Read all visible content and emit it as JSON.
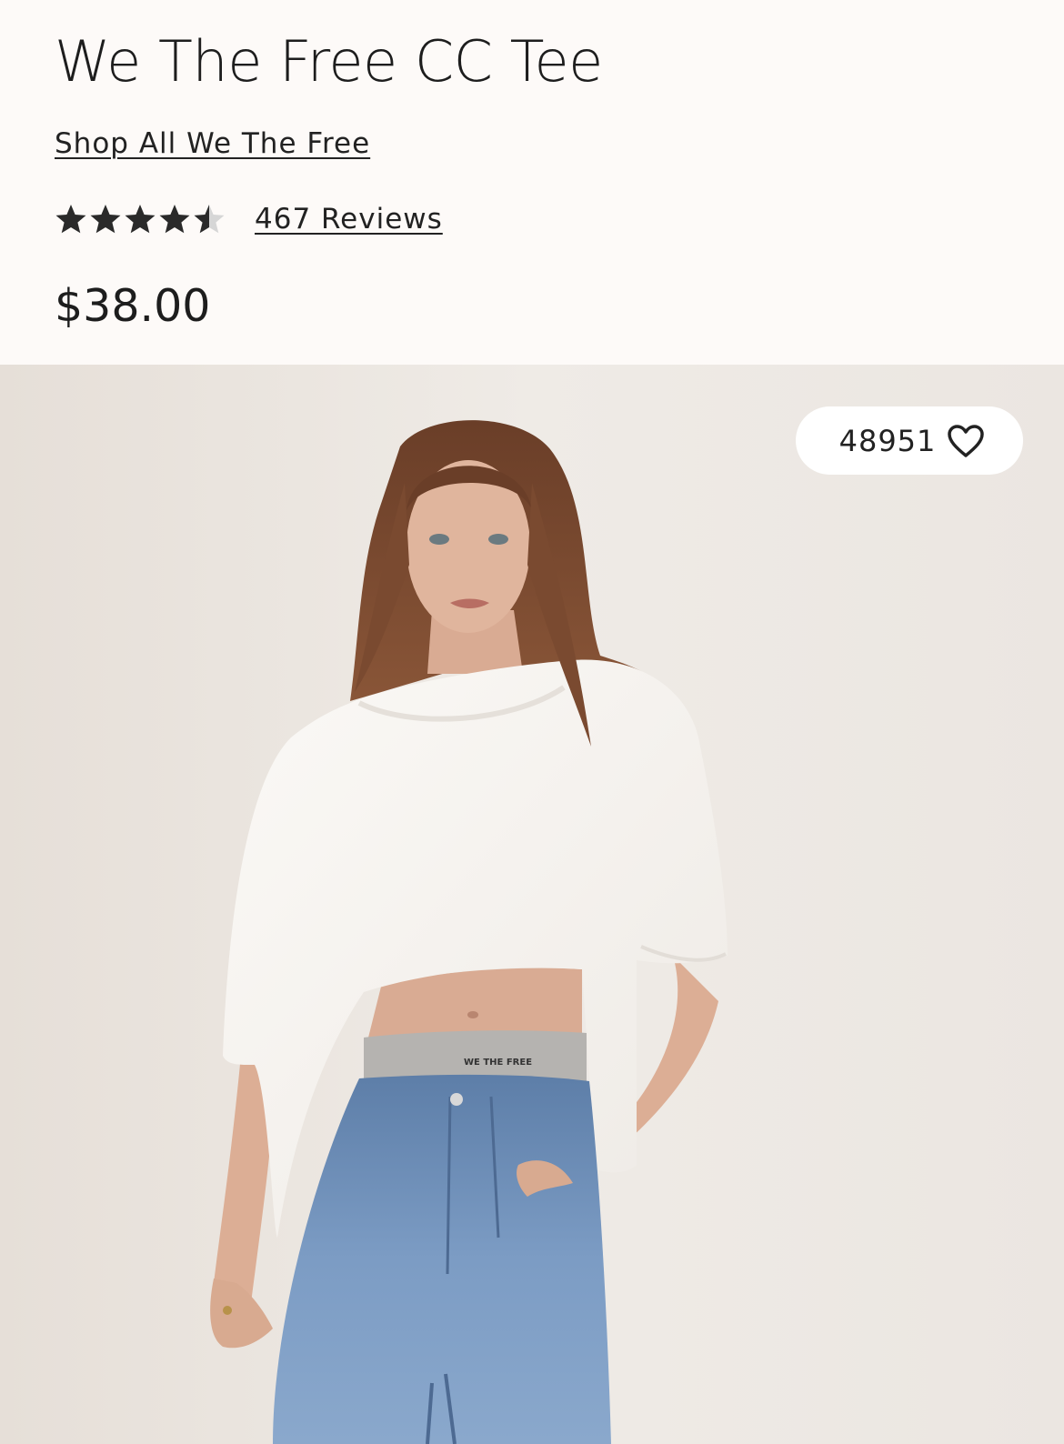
{
  "product": {
    "title": "We The Free CC Tee",
    "shop_all_link": "Shop All We The Free",
    "rating": {
      "value": 4.5,
      "max": 5,
      "reviews_label": "467 Reviews"
    },
    "price": "$38.00"
  },
  "image": {
    "favorite_count": "48951",
    "favorite_icon": "heart-icon",
    "waistband_text": "WE THE FREE"
  },
  "colors": {
    "background": "#fdfaf8",
    "text": "#1d1d1d",
    "star": "#2a2a2a",
    "star_empty": "#d6d6d6",
    "pill": "#ffffff"
  }
}
